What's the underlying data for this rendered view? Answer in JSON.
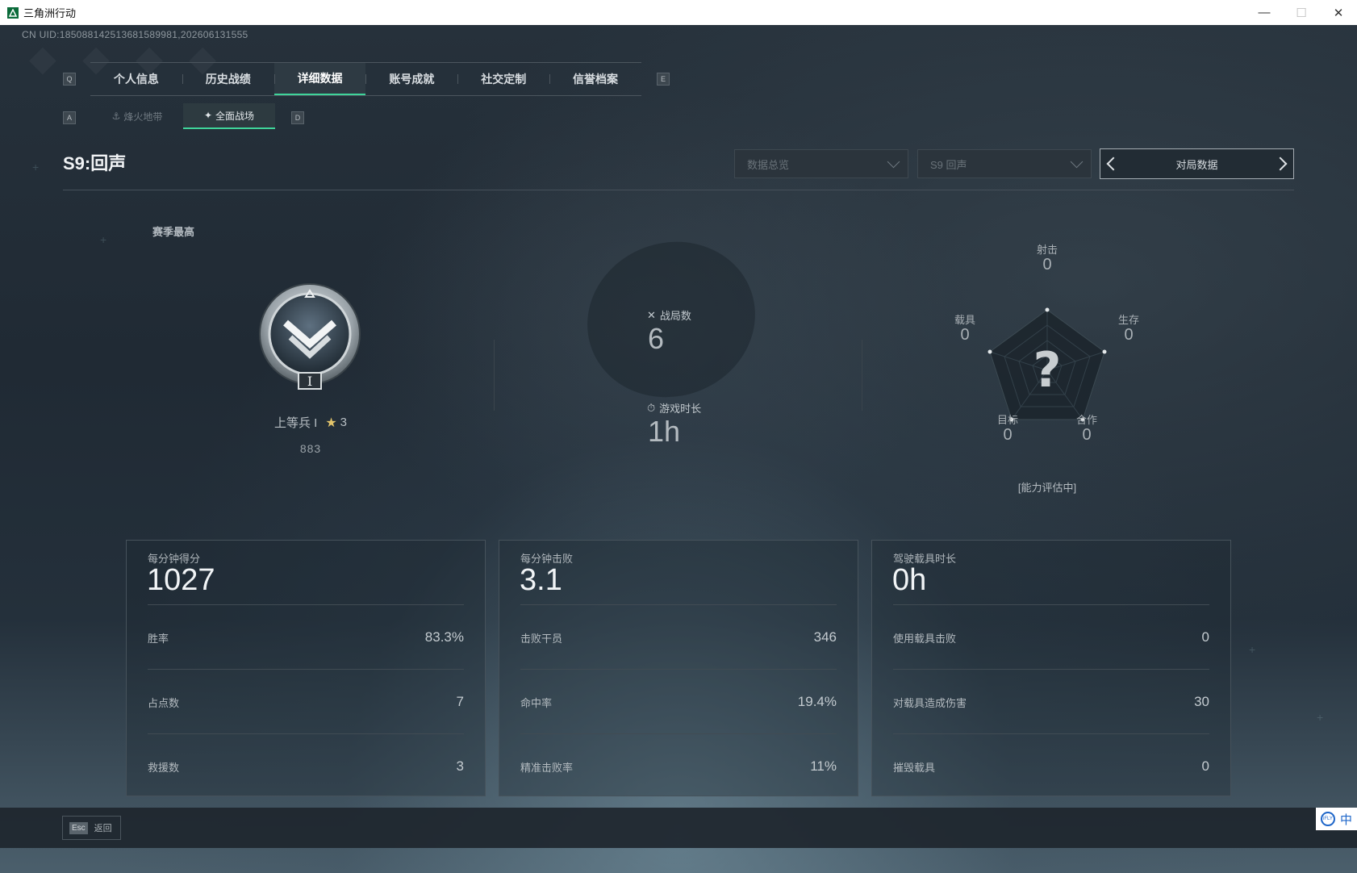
{
  "window": {
    "title": "三角洲行动",
    "minimize": "—",
    "maximize": "☐",
    "close": "✕"
  },
  "uid": "CN UID:18508814251368158998​1,202606131555",
  "keys": {
    "left_tab": "Q",
    "right_tab": "E",
    "left_sub": "A",
    "right_sub": "D"
  },
  "tabs": [
    {
      "label": "个人信息"
    },
    {
      "label": "历史战绩"
    },
    {
      "label": "详细数据"
    },
    {
      "label": "账号成就"
    },
    {
      "label": "社交定制"
    },
    {
      "label": "信誉档案"
    }
  ],
  "subtabs": [
    {
      "label": "烽火地带",
      "icon": "⚓"
    },
    {
      "label": "全面战场",
      "icon": "✦"
    }
  ],
  "season": {
    "title": "S9:回声"
  },
  "filters": {
    "data_overview": "数据总览",
    "season_select": "S9 回声",
    "match_data": "对局数据"
  },
  "season_best": {
    "label": "赛季最高",
    "rank_name": "上等兵 I",
    "stars": "3",
    "points": "883",
    "badge_numeral": "I"
  },
  "matches": {
    "label": "战局数",
    "value": "6"
  },
  "playtime": {
    "label": "游戏时长",
    "value": "1h"
  },
  "radar": {
    "question": "?",
    "status": "[能力评估中]",
    "axes": [
      {
        "label": "射击",
        "value": "0"
      },
      {
        "label": "生存",
        "value": "0"
      },
      {
        "label": "合作",
        "value": "0"
      },
      {
        "label": "目标",
        "value": "0"
      },
      {
        "label": "载具",
        "value": "0"
      }
    ]
  },
  "cards": [
    {
      "head_label": "每分钟得分",
      "head_value": "1027",
      "rows": [
        {
          "k": "胜率",
          "v": "83.3%"
        },
        {
          "k": "占点数",
          "v": "7"
        },
        {
          "k": "救援数",
          "v": "3"
        }
      ]
    },
    {
      "head_label": "每分钟击败",
      "head_value": "3.1",
      "rows": [
        {
          "k": "击败干员",
          "v": "346"
        },
        {
          "k": "命中率",
          "v": "19.4%"
        },
        {
          "k": "精准击败率",
          "v": "11%"
        }
      ]
    },
    {
      "head_label": "驾驶载具时长",
      "head_value": "0h",
      "rows": [
        {
          "k": "使用载具击败",
          "v": "0"
        },
        {
          "k": "对载具造成伤害",
          "v": "30"
        },
        {
          "k": "摧毁载具",
          "v": "0"
        }
      ]
    }
  ],
  "footer": {
    "esc_key": "Esc",
    "back": "返回"
  },
  "ime": {
    "logo": "iFLY",
    "mode": "中"
  },
  "colors": {
    "accent": "#3fd49a",
    "background": "#1b2530"
  }
}
